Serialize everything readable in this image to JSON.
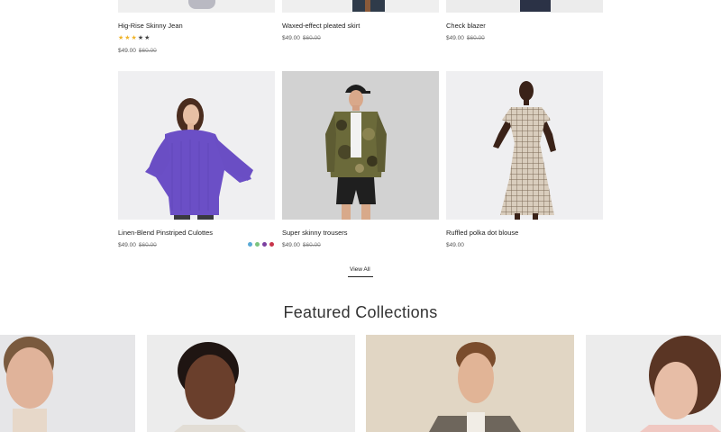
{
  "products_top": [
    {
      "name": "Hig-Rise Skinny Jean",
      "price": "$49.00",
      "old_price": "$60.00",
      "rating": 3,
      "max_rating": 5
    },
    {
      "name": "Waxed-effect pleated skirt",
      "price": "$49.00",
      "old_price": "$60.00"
    },
    {
      "name": "Check blazer",
      "price": "$49.00",
      "old_price": "$60.00"
    }
  ],
  "products_bottom": [
    {
      "name": "Linen-Blend Pinstriped Culottes",
      "price": "$49.00",
      "old_price": "$60.00",
      "swatches": [
        "#5aa9d6",
        "#7cc47f",
        "#7b3fa0",
        "#c8344a"
      ]
    },
    {
      "name": "Super skinny trousers",
      "price": "$49.00",
      "old_price": "$60.00"
    },
    {
      "name": "Ruffled polka dot blouse",
      "price": "$49.00"
    }
  ],
  "view_all_label": "View All",
  "featured_heading": "Featured Collections"
}
